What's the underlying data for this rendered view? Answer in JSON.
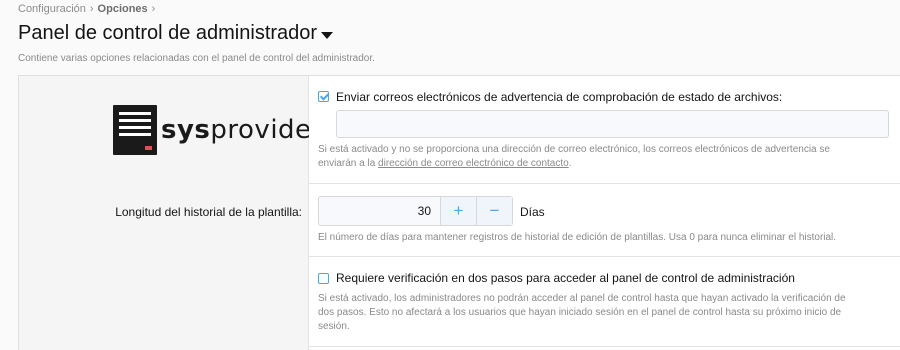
{
  "breadcrumb": {
    "items": [
      "Configuración",
      "Opciones"
    ],
    "separator": "›"
  },
  "page": {
    "title": "Panel de control de administrador",
    "description": "Contiene varias opciones relacionadas con el panel de control del administrador."
  },
  "logo": {
    "text_bold": "sys",
    "text_regular": "provider"
  },
  "options": {
    "email_warning": {
      "label": "Enviar correos electrónicos de advertencia de comprobación de estado de archivos:",
      "checked": true,
      "input_value": "",
      "hint_line1": "Si está activado y no se proporciona una dirección de correo electrónico, los correos electrónicos de advertencia se",
      "hint_line2_prefix": "enviarán a la ",
      "hint_link": "dirección de correo electrónico de contacto",
      "hint_line2_suffix": "."
    },
    "history_length": {
      "label": "Longitud del historial de la plantilla:",
      "value": "30",
      "plus": "+",
      "minus": "−",
      "unit": "Días",
      "hint": "El número de días para mantener registros de historial de edición de plantillas. Usa 0 para nunca eliminar el historial."
    },
    "two_step": {
      "label": "Requiere verificación en dos pasos para acceder al panel de control de administración",
      "checked": false,
      "hint_line1": "Si está activado, los administradores no podrán acceder al panel de control hasta que hayan activado la verificación de",
      "hint_line2": "dos pasos. Esto no afectará a los usuarios que hayan iniciado sesión en el panel de control hasta su próximo inicio de",
      "hint_line3": "sesión."
    }
  },
  "colors": {
    "accent": "#47a7eb",
    "text": "#141414",
    "muted": "#8a8a8a"
  }
}
